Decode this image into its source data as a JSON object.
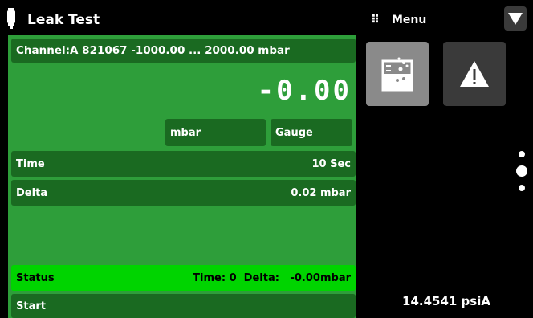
{
  "header": {
    "title": "Leak Test",
    "menu_label": "Menu",
    "menu_grip": "⠿"
  },
  "channel": {
    "label": "Channel:A 821067 -1000.00 ... 2000.00 mbar"
  },
  "reading": {
    "value": "-0.00",
    "unit": "mbar",
    "mode": "Gauge"
  },
  "params": {
    "time_label": "Time",
    "time_value": "10 Sec",
    "delta_label": "Delta",
    "delta_value": "0.02 mbar"
  },
  "status": {
    "label": "Status",
    "detail": "Time: 0  Delta:   -0.00mbar"
  },
  "start": {
    "label": "Start"
  },
  "barometer": {
    "value": "14.4541 psiA"
  },
  "icons": {
    "title_icon": "thermometer-icon",
    "menu_dropdown": "triangle-down-icon",
    "lab_button": "beaker-icon",
    "warning_button": "warning-icon",
    "more": "vertical-dots-icon"
  },
  "colors": {
    "panel": "#2e9e3a",
    "row": "#1a6a21",
    "status": "#00d400",
    "background": "#000000"
  }
}
